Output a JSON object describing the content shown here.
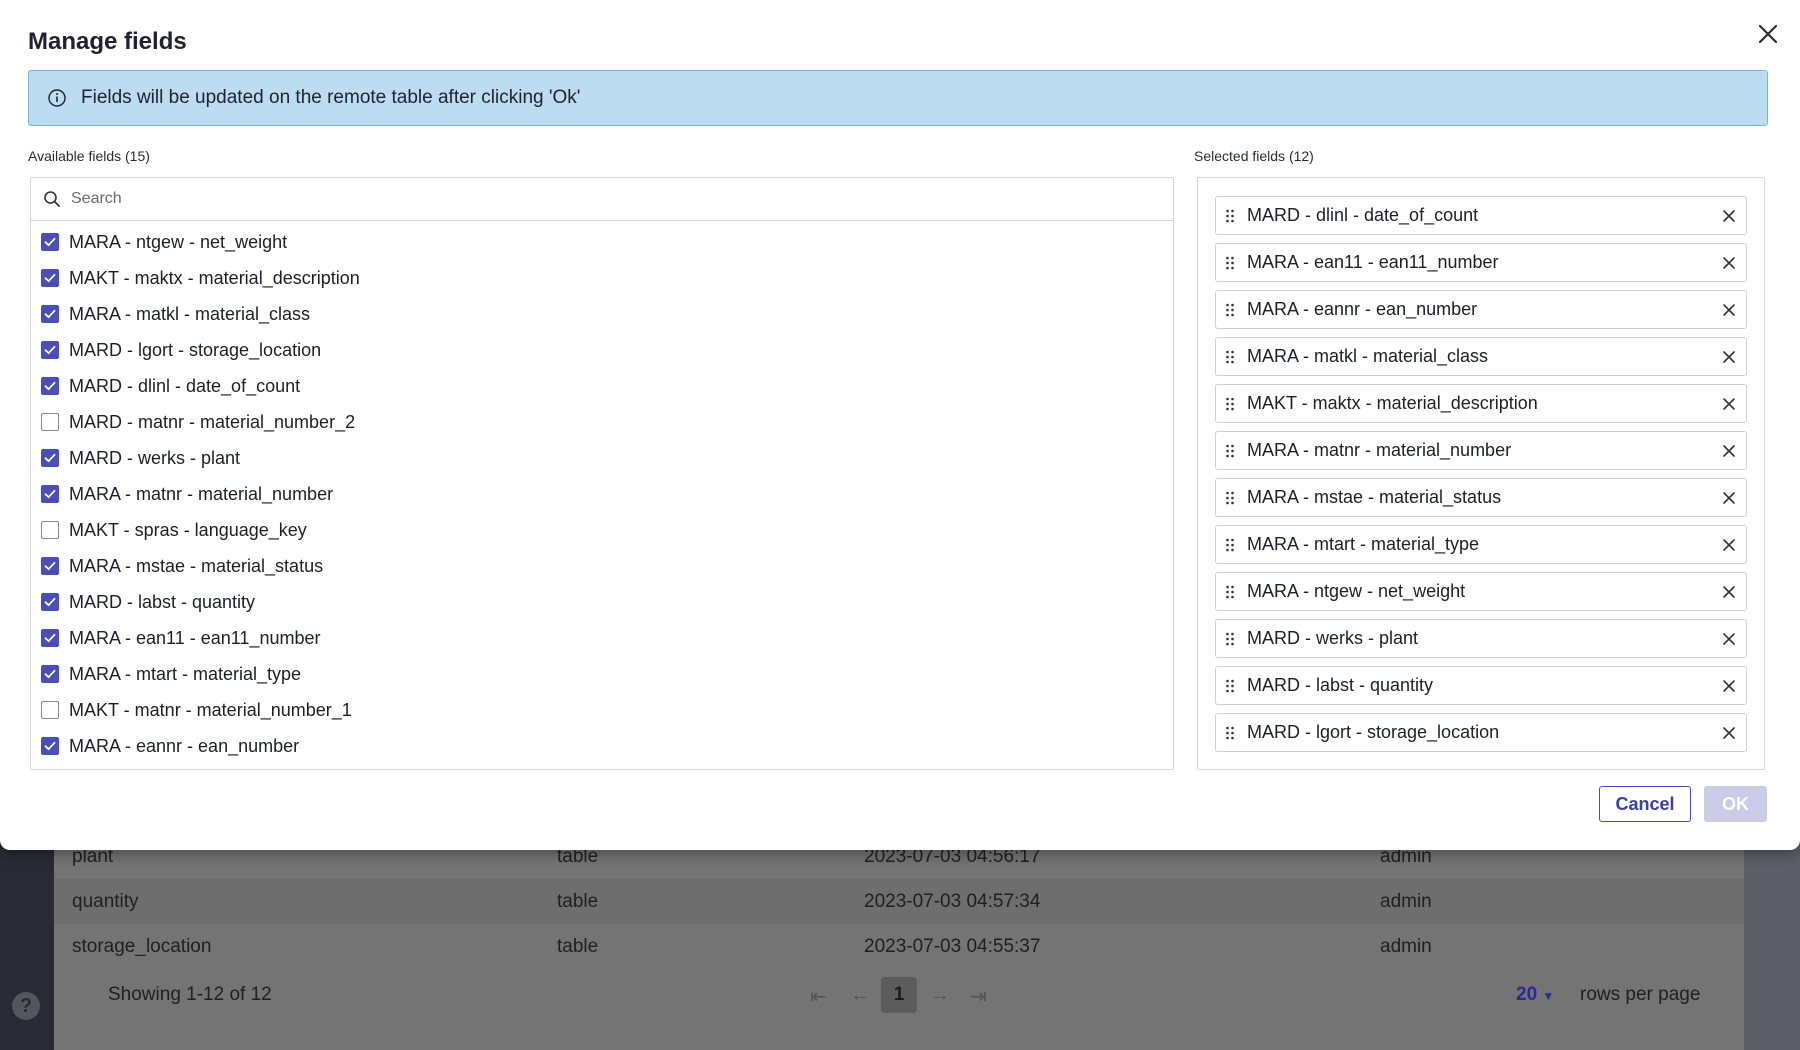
{
  "modal": {
    "title": "Manage fields",
    "banner_text": "Fields will be updated on the remote table after clicking 'Ok'",
    "available_label": "Available fields (15)",
    "selected_label": "Selected fields (12)",
    "search_placeholder": "Search",
    "available_fields": [
      {
        "label": "MARA - ntgew - net_weight",
        "checked": true
      },
      {
        "label": "MAKT - maktx - material_description",
        "checked": true
      },
      {
        "label": "MARA - matkl - material_class",
        "checked": true
      },
      {
        "label": "MARD - lgort - storage_location",
        "checked": true
      },
      {
        "label": "MARD - dlinl - date_of_count",
        "checked": true
      },
      {
        "label": "MARD - matnr - material_number_2",
        "checked": false
      },
      {
        "label": "MARD - werks - plant",
        "checked": true
      },
      {
        "label": "MARA - matnr - material_number",
        "checked": true
      },
      {
        "label": "MAKT - spras - language_key",
        "checked": false
      },
      {
        "label": "MARA - mstae - material_status",
        "checked": true
      },
      {
        "label": "MARD - labst - quantity",
        "checked": true
      },
      {
        "label": "MARA - ean11 - ean11_number",
        "checked": true
      },
      {
        "label": "MARA - mtart - material_type",
        "checked": true
      },
      {
        "label": "MAKT - matnr - material_number_1",
        "checked": false
      },
      {
        "label": "MARA - eannr - ean_number",
        "checked": true
      }
    ],
    "selected_fields": [
      "MARD - dlinl - date_of_count",
      "MARA - ean11 - ean11_number",
      "MARA - eannr - ean_number",
      "MARA - matkl - material_class",
      "MAKT - maktx - material_description",
      "MARA - matnr - material_number",
      "MARA - mstae - material_status",
      "MARA - mtart - material_type",
      "MARA - ntgew - net_weight",
      "MARD - werks - plant",
      "MARD - labst - quantity",
      "MARD - lgort - storage_location"
    ],
    "cancel_label": "Cancel",
    "ok_label": "OK"
  },
  "background": {
    "rows": [
      {
        "name": "plant",
        "type": "table",
        "timestamp": "2023-07-03 04:56:17",
        "user": "admin"
      },
      {
        "name": "quantity",
        "type": "table",
        "timestamp": "2023-07-03 04:57:34",
        "user": "admin"
      },
      {
        "name": "storage_location",
        "type": "table",
        "timestamp": "2023-07-03 04:55:37",
        "user": "admin"
      }
    ],
    "showing_text": "Showing 1-12 of 12",
    "current_page": "1",
    "rows_per_page_value": "20",
    "rows_per_page_label": "rows per page"
  },
  "colors": {
    "accent": "#4a4fb8",
    "banner_bg": "#bcdcf2",
    "ok_disabled": "#c9cbe8"
  }
}
